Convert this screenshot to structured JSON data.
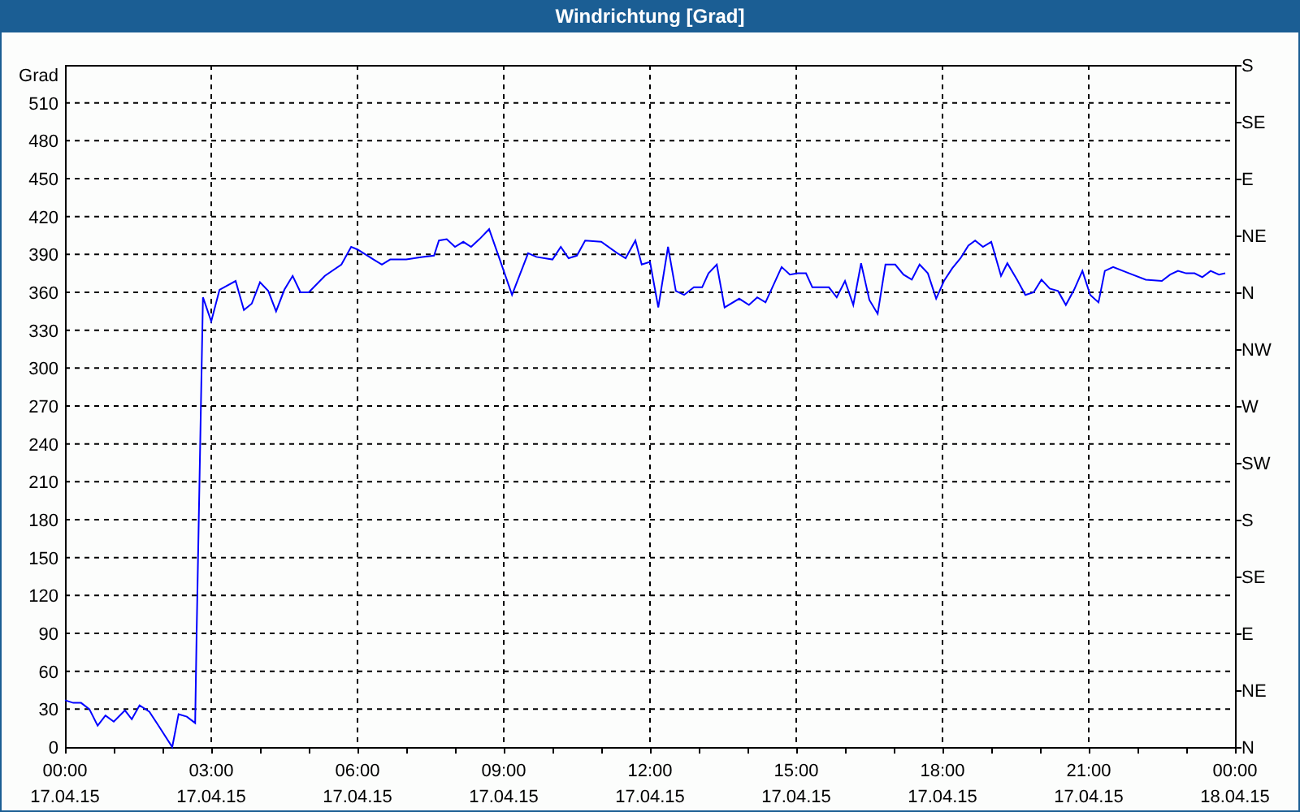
{
  "window": {
    "title": "Windrichtung [Grad]"
  },
  "chart": {
    "chart_data": {
      "type": "line",
      "ylabel": "Grad",
      "xlim": [
        0,
        24
      ],
      "ylim": [
        0,
        540
      ],
      "xticks": [
        {
          "value": 0,
          "label": "00:00"
        },
        {
          "value": 3,
          "label": "03:00"
        },
        {
          "value": 6,
          "label": "06:00"
        },
        {
          "value": 9,
          "label": "09:00"
        },
        {
          "value": 12,
          "label": "12:00"
        },
        {
          "value": 15,
          "label": "15:00"
        },
        {
          "value": 18,
          "label": "18:00"
        },
        {
          "value": 21,
          "label": "21:00"
        },
        {
          "value": 24,
          "label": "00:00"
        }
      ],
      "yticks": [
        0,
        30,
        60,
        90,
        120,
        150,
        180,
        210,
        240,
        270,
        300,
        330,
        360,
        390,
        420,
        450,
        480,
        510
      ],
      "grid": true,
      "x": [
        0,
        0.17,
        0.33,
        0.5,
        0.67,
        0.83,
        1.0,
        1.23,
        1.37,
        1.53,
        1.73,
        1.9,
        2.2,
        2.33,
        2.5,
        2.67,
        2.7,
        2.83,
        3.0,
        3.17,
        3.5,
        3.67,
        3.83,
        4.0,
        4.17,
        4.33,
        4.5,
        4.67,
        4.83,
        5.0,
        5.33,
        5.67,
        5.87,
        6.0,
        6.33,
        6.5,
        6.67,
        7.0,
        7.33,
        7.57,
        7.67,
        7.83,
        8.0,
        8.17,
        8.33,
        8.5,
        8.7,
        8.9,
        9.17,
        9.5,
        9.67,
        10.0,
        10.17,
        10.33,
        10.5,
        10.67,
        11.0,
        11.33,
        11.5,
        11.7,
        11.83,
        12.0,
        12.17,
        12.37,
        12.53,
        12.7,
        12.9,
        13.07,
        13.2,
        13.37,
        13.53,
        13.83,
        14.03,
        14.2,
        14.37,
        14.7,
        14.87,
        15.03,
        15.2,
        15.33,
        15.67,
        15.83,
        16.0,
        16.17,
        16.33,
        16.5,
        16.67,
        16.83,
        17.03,
        17.2,
        17.37,
        17.53,
        17.7,
        17.87,
        18.03,
        18.2,
        18.37,
        18.53,
        18.67,
        18.83,
        19.0,
        19.2,
        19.33,
        19.53,
        19.7,
        19.87,
        20.03,
        20.2,
        20.37,
        20.53,
        20.7,
        20.87,
        21.03,
        21.2,
        21.33,
        21.5,
        21.83,
        22.17,
        22.5,
        22.67,
        22.83,
        23.0,
        23.17,
        23.33,
        23.5,
        23.67,
        23.8
      ],
      "series": [
        {
          "color": "#0000ff",
          "values": [
            37,
            35,
            35,
            30,
            17,
            25,
            20,
            29,
            22,
            33,
            28,
            18,
            0,
            26,
            24,
            19,
            90,
            356,
            337,
            362,
            369,
            346,
            351,
            368,
            361,
            345,
            362,
            373,
            360,
            360,
            373,
            382,
            396,
            394,
            386,
            382,
            386,
            386,
            388,
            389,
            401,
            402,
            396,
            400,
            396,
            402,
            410,
            388,
            358,
            391,
            388,
            386,
            396,
            387,
            389,
            401,
            400,
            391,
            387,
            401,
            382,
            384,
            348,
            396,
            361,
            358,
            364,
            364,
            375,
            382,
            348,
            355,
            350,
            356,
            352,
            380,
            374,
            375,
            375,
            364,
            364,
            356,
            369,
            350,
            383,
            354,
            343,
            382,
            382,
            374,
            370,
            382,
            375,
            355,
            369,
            379,
            387,
            397,
            401,
            396,
            400,
            373,
            383,
            370,
            358,
            360,
            370,
            363,
            361,
            350,
            362,
            377,
            358,
            352,
            377,
            380,
            375,
            370,
            369,
            374,
            377,
            375,
            375,
            372,
            377,
            374,
            375
          ]
        }
      ]
    },
    "date_labels": [
      "17.04.15",
      "17.04.15",
      "17.04.15",
      "17.04.15",
      "17.04.15",
      "17.04.15",
      "17.04.15",
      "17.04.15",
      "18.04.15"
    ],
    "compass_labels": [
      "S",
      "SE",
      "E",
      "NE",
      "N",
      "NW",
      "W",
      "SW",
      "S",
      "SE",
      "E",
      "NE",
      "N"
    ]
  }
}
